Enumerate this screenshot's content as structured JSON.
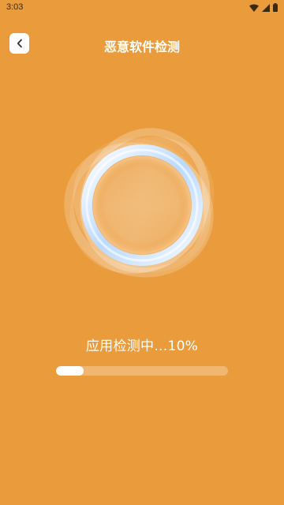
{
  "status_bar": {
    "time": "3:03",
    "icons": [
      "wifi-icon",
      "signal-icon",
      "battery-icon"
    ]
  },
  "header": {
    "title": "恶意软件检测",
    "back_icon": "chevron-left-icon"
  },
  "scan": {
    "status_label": "应用检测中...10%",
    "progress": 0.16
  },
  "colors": {
    "background": "#ea9b3b",
    "ring": "#cfe4ff",
    "text": "#ffffff"
  }
}
